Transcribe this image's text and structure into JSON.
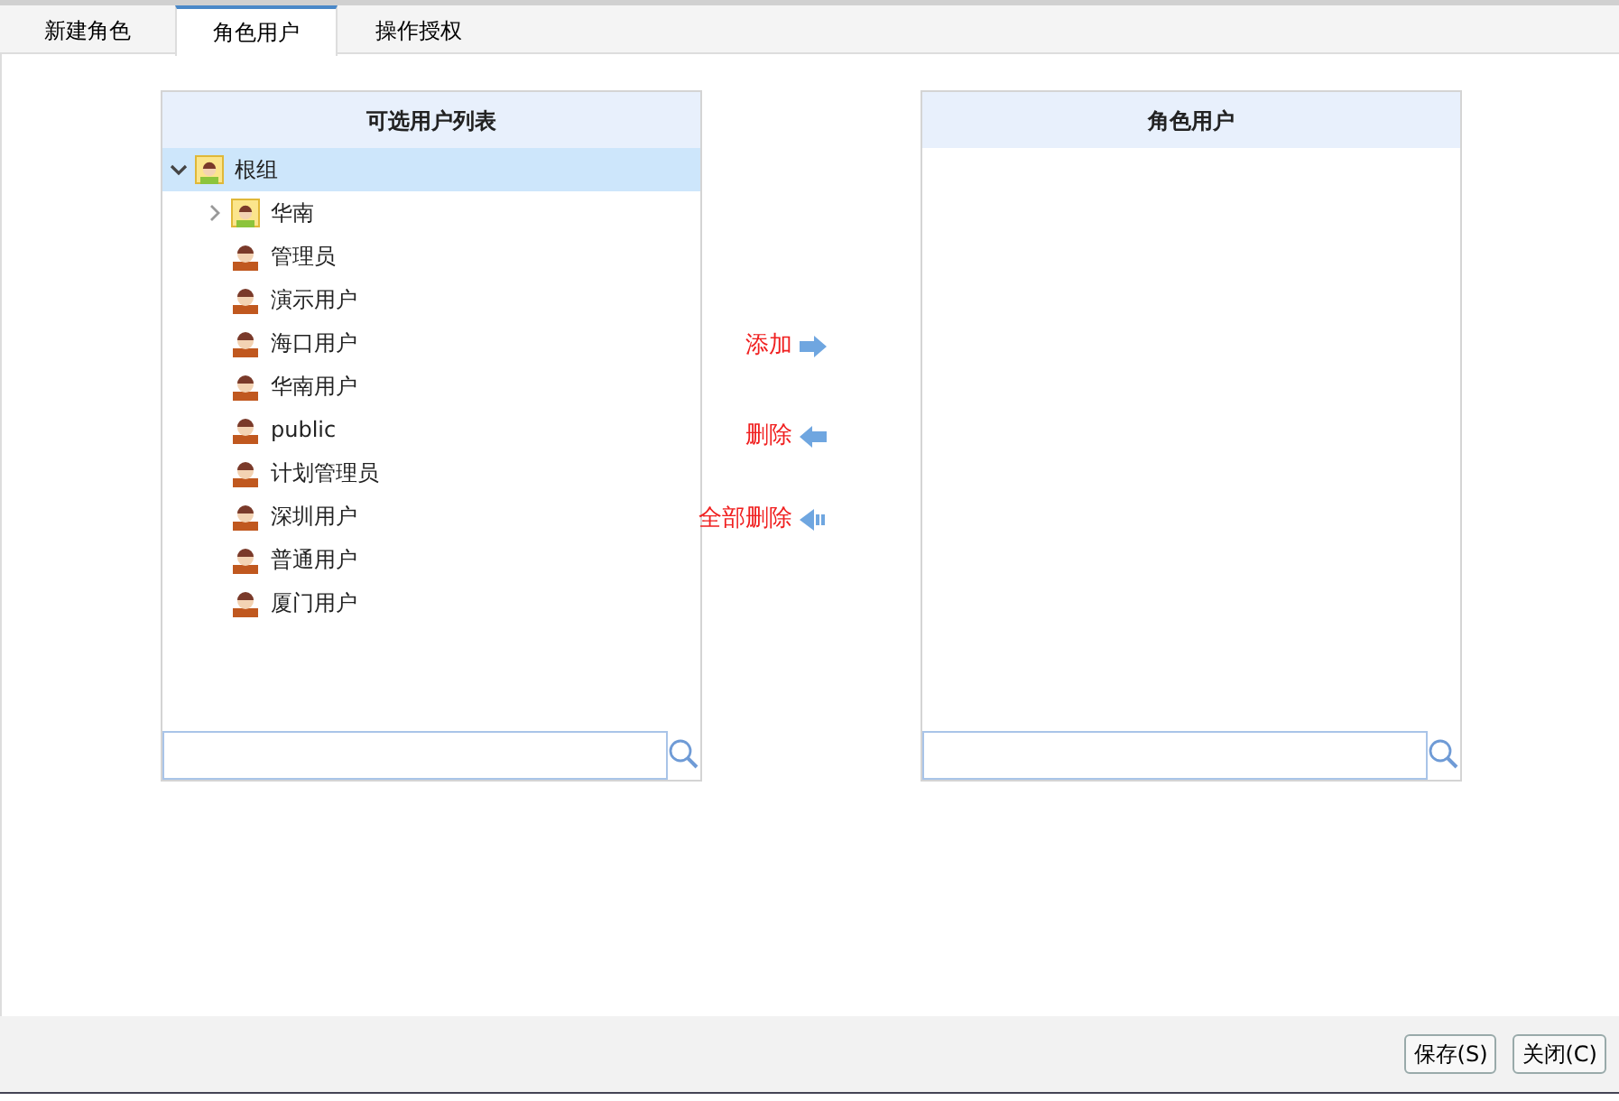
{
  "tabs": [
    {
      "label": "新建角色",
      "selected": false
    },
    {
      "label": "角色用户",
      "selected": true
    },
    {
      "label": "操作授权",
      "selected": false
    }
  ],
  "available_panel": {
    "title": "可选用户列表",
    "tree": [
      {
        "label": "根组",
        "kind": "group",
        "expanded": true,
        "selected": true,
        "children": [
          {
            "label": "华南",
            "kind": "group",
            "expanded": false,
            "selected": false
          },
          {
            "label": "管理员",
            "kind": "user",
            "selected": false
          },
          {
            "label": "演示用户",
            "kind": "user",
            "selected": false
          },
          {
            "label": "海口用户",
            "kind": "user",
            "selected": false
          },
          {
            "label": "华南用户",
            "kind": "user",
            "selected": false
          },
          {
            "label": "public",
            "kind": "user",
            "selected": false
          },
          {
            "label": "计划管理员",
            "kind": "user",
            "selected": false
          },
          {
            "label": "深圳用户",
            "kind": "user",
            "selected": false
          },
          {
            "label": "普通用户",
            "kind": "user",
            "selected": false
          },
          {
            "label": "厦门用户",
            "kind": "user",
            "selected": false
          }
        ]
      }
    ]
  },
  "actions": [
    {
      "label": "添加",
      "kind": "add"
    },
    {
      "label": "删除",
      "kind": "remove"
    },
    {
      "label": "全部删除",
      "kind": "remove-all"
    }
  ],
  "role_panel": {
    "title": "角色用户"
  },
  "buttons": [
    "保存(S)",
    "关闭(C)"
  ]
}
